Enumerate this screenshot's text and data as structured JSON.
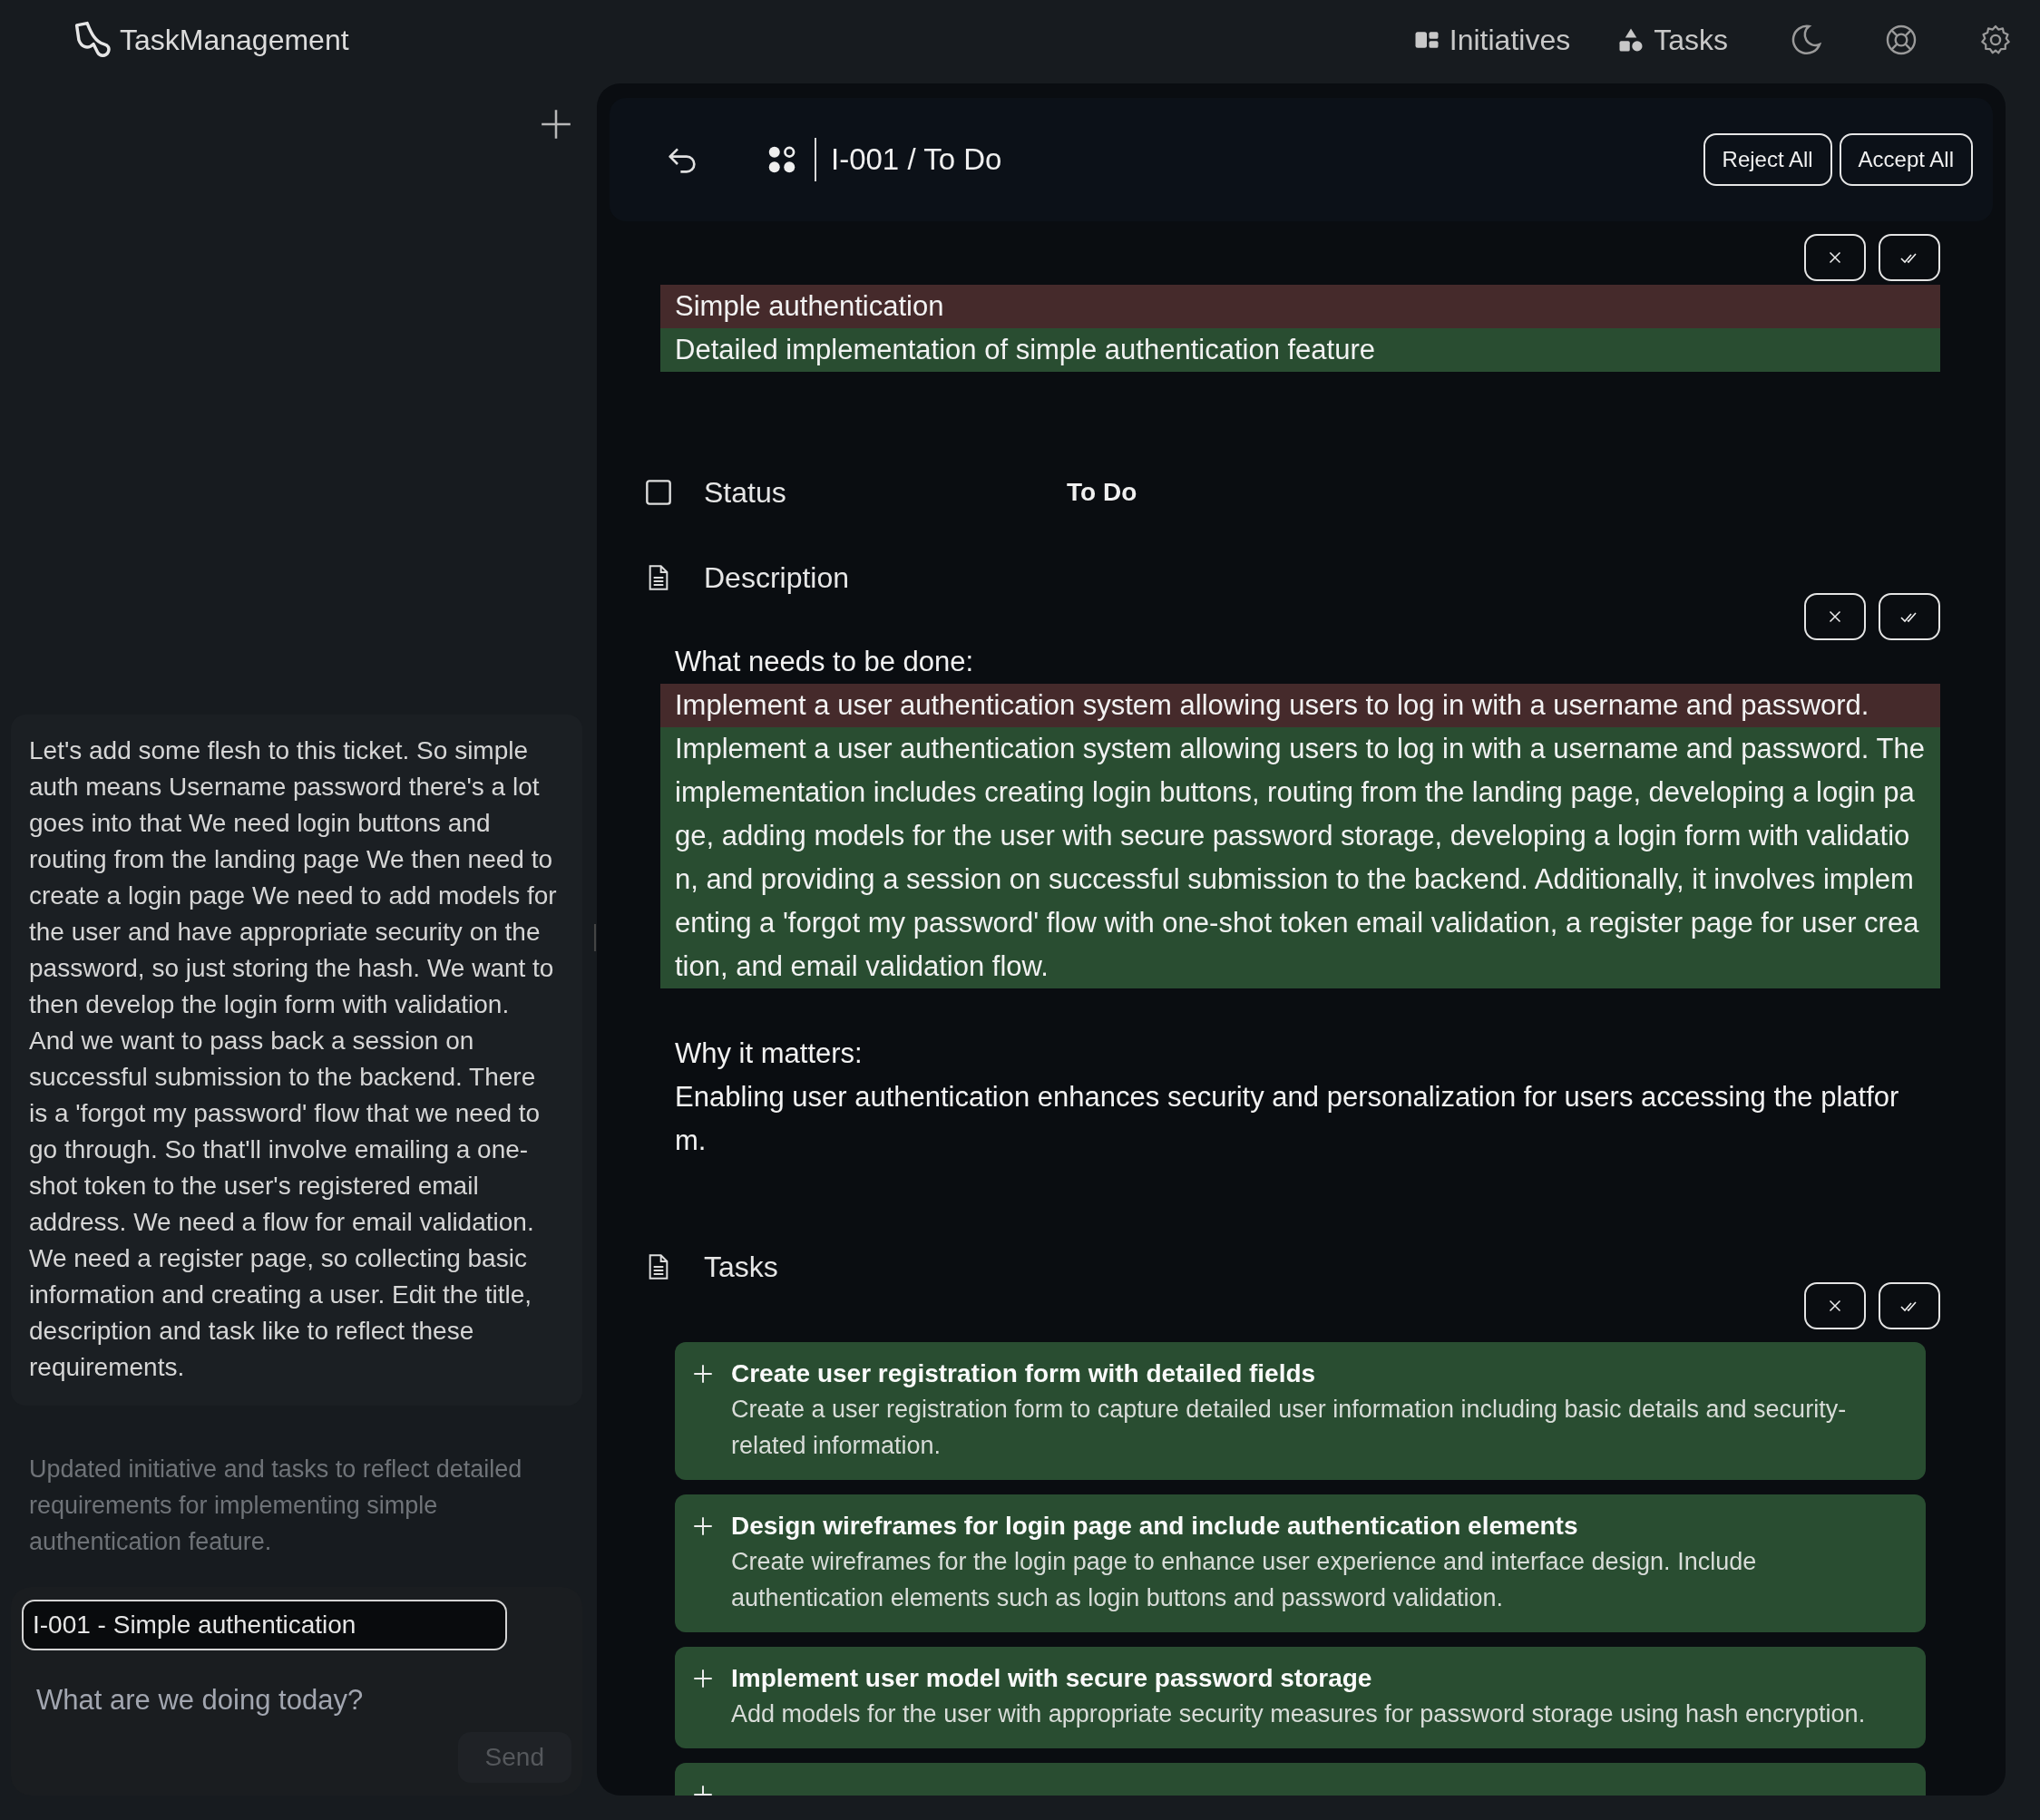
{
  "app": {
    "name": "TaskManagement"
  },
  "nav": [
    {
      "label": "Initiatives"
    },
    {
      "label": "Tasks"
    }
  ],
  "chat": {
    "prompt": "Let's add some flesh to this ticket. So simple auth means Username password there's a lot goes into that We need login buttons and routing from the landing page We then need to create a login page We need to add models for the user and have appropriate security on the password, so just storing the hash. We want to then develop the login form with validation. And we want to pass back a session on successful submission to the backend. There is a 'forgot my password' flow that we need to go through. So that'll involve emailing a one-shot token to the user's registered email address. We need a flow for email validation. We need a register page, so collecting basic information and creating a user. Edit the title, description and task like to reflect these requirements.",
    "reply": "Updated initiative and tasks to reflect detailed requirements for implementing simple authentication feature.",
    "context": "I-001 - Simple authentication",
    "placeholder": "What are we doing today?",
    "send": {
      "label": "Send",
      "disabled": true
    }
  },
  "detail": {
    "breadcrumb": "I-001 / To Do",
    "buttons": [
      "Reject All",
      "Accept All"
    ],
    "title_diff": [
      {
        "kind": "removed",
        "text": "Simple authentication"
      },
      {
        "kind": "added",
        "text": "Detailed implementation of simple authentication feature"
      }
    ],
    "fields": [
      {
        "label": "Status",
        "value": "To Do"
      }
    ],
    "description": {
      "label": "Description",
      "sections": [
        {
          "lines": [
            {
              "kind": "plain",
              "text": "What needs to be done:"
            },
            {
              "kind": "removed",
              "text": "Implement a user authentication system allowing users to log in with a username and password."
            },
            {
              "kind": "added",
              "text": "Implement a user authentication system allowing users to log in with a username and password. The implementation includes creating login buttons, routing from the landing page, developing a login page, adding models for the user with secure password storage, developing a login form with validation, and providing a session on successful submission to the backend. Additionally, it involves implementing a 'forgot my password' flow with one-shot token email validation, a register page for user creation, and email validation flow."
            }
          ]
        },
        {
          "lines": [
            {
              "kind": "plain",
              "text": "Why it matters:"
            },
            {
              "kind": "plain",
              "text": "Enabling user authentication enhances security and personalization for users accessing the platform."
            }
          ]
        }
      ]
    },
    "tasks": {
      "label": "Tasks",
      "items": [
        {
          "kind": "added",
          "title": "Create user registration form with detailed fields",
          "description": "Create a user registration form to capture detailed user information including basic details and security-related information."
        },
        {
          "kind": "added",
          "title": "Design wireframes for login page and include authentication elements",
          "description": "Create wireframes for the login page to enhance user experience and interface design. Include authentication elements such as login buttons and password validation."
        },
        {
          "kind": "added",
          "title": "Implement user model with secure password storage",
          "description": "Add models for the user with appropriate security measures for password storage using hash encryption."
        },
        {
          "kind": "added"
        }
      ]
    }
  }
}
